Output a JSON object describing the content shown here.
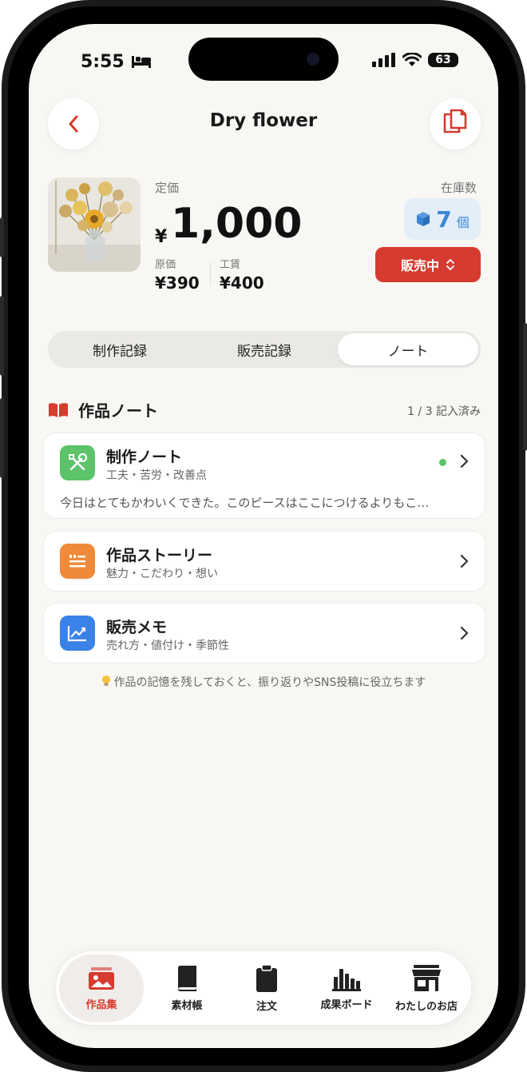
{
  "status": {
    "time": "5:55",
    "battery": "63"
  },
  "header": {
    "title": "Dry flower",
    "back_icon": "chevron-left-icon",
    "copy_icon": "copy-icon"
  },
  "product": {
    "price_label": "定価",
    "currency": "¥",
    "price": "1,000",
    "cost_label": "原価",
    "cost": "¥390",
    "labor_label": "工賃",
    "labor": "¥400",
    "stock_label": "在庫数",
    "stock_value": "7",
    "stock_unit": "個",
    "status_button": "販売中"
  },
  "segments": {
    "items": [
      "制作記録",
      "販売記録",
      "ノート"
    ],
    "active_index": 2
  },
  "notes": {
    "section_title": "作品ノート",
    "count_text": "1 / 3 記入済み",
    "cards": [
      {
        "title": "制作ノート",
        "subtitle": "工夫・苦労・改善点",
        "preview": "今日はとてもかわいくできた。このピースはここにつけるよりもこ…",
        "has_entry": true,
        "icon": "tools-icon",
        "color": "#5cc36b"
      },
      {
        "title": "作品ストーリー",
        "subtitle": "魅力・こだわり・想い",
        "icon": "quote-icon",
        "color": "#f08a3a"
      },
      {
        "title": "販売メモ",
        "subtitle": "売れ方・値付け・季節性",
        "icon": "chart-icon",
        "color": "#3b82e8"
      }
    ],
    "hint": "作品の記憶を残しておくと、振り返りやSNS投稿に役立ちます"
  },
  "tabbar": {
    "items": [
      {
        "label": "作品集",
        "icon": "gallery-icon",
        "active": true
      },
      {
        "label": "素材帳",
        "icon": "book-icon"
      },
      {
        "label": "注文",
        "icon": "clipboard-icon"
      },
      {
        "label": "成果ボード",
        "icon": "bar-chart-icon"
      },
      {
        "label": "わたしのお店",
        "icon": "store-icon"
      }
    ]
  },
  "colors": {
    "accent": "#d63b2f",
    "stock_blue": "#3a86d6",
    "background": "#f8f7f4"
  }
}
